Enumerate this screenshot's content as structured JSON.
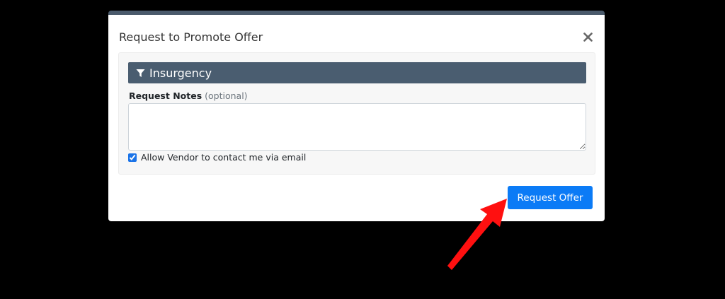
{
  "modal": {
    "title": "Request to Promote Offer",
    "close_icon": "close-icon"
  },
  "panel": {
    "title": "Insurgency",
    "title_icon": "filter-icon"
  },
  "notes": {
    "label": "Request Notes",
    "optional": "(optional)",
    "value": ""
  },
  "contact": {
    "label": "Allow Vendor to contact me via email",
    "checked": true
  },
  "actions": {
    "request_label": "Request Offer"
  },
  "colors": {
    "header_bar": "#4a5d70",
    "primary": "#0b7bf6",
    "annotation_arrow": "#ff0000"
  }
}
